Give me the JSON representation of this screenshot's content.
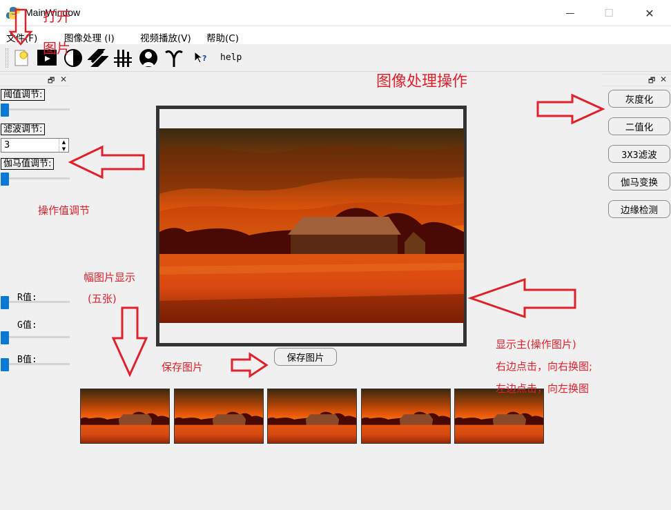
{
  "window": {
    "title": "MainWindow",
    "minimize": "—",
    "maximize": "☐",
    "close": "✕"
  },
  "menu": [
    {
      "label": "文件(F)"
    },
    {
      "label": "图像处理 (I)"
    },
    {
      "label": "视频播放(V)"
    },
    {
      "label": "帮助(C)"
    }
  ],
  "toolbar": {
    "help_label": "help"
  },
  "left_dock": {
    "threshold_label": "阈值调节:",
    "filter_label": "滤波调节:",
    "filter_value": "3",
    "gamma_label": "伽马值调节:",
    "r_label": "R值:",
    "g_label": "G值:",
    "b_label": "B值:"
  },
  "right_dock": {
    "buttons": [
      "灰度化",
      "二值化",
      "3X3滤波",
      "伽马变换",
      "边缘检测"
    ]
  },
  "save_button": "保存图片",
  "thumbnails_count": 5,
  "annotations": {
    "open": "打开",
    "image": "图片",
    "ops_title": "图像处理操作",
    "value_adjust": "操作值调节",
    "thumbs_line1": "幅图片显示",
    "thumbs_line2": "(五张)",
    "save": "保存图片",
    "main_line1": "显示主(操作图片)",
    "main_line2": "右边点击，向右换图;",
    "main_line3": "左边点击，向左换图"
  },
  "colors": {
    "accent": "#0a78d7",
    "annotation": "#e0202a"
  }
}
